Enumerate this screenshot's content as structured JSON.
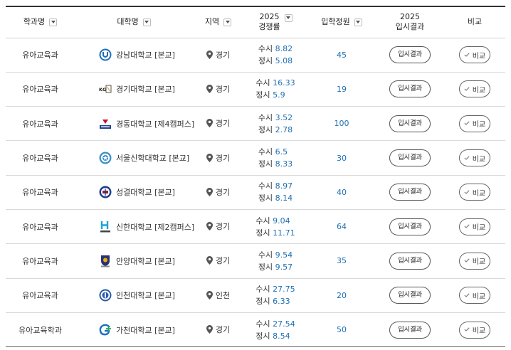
{
  "headers": {
    "dept": "학과명",
    "univ": "대학명",
    "region": "지역",
    "rate_top": "2025",
    "rate_bottom": "경쟁률",
    "quota": "입학정원",
    "result_top": "2025",
    "result_bottom": "입시결과",
    "compare": "비교"
  },
  "susi_label": "수시",
  "jeongsi_label": "정시",
  "result_label": "입시결과",
  "compare_label": "비교",
  "colors": {
    "value_blue": "#1f6fb2",
    "header_border": "#333333"
  },
  "rows": [
    {
      "dept": "유아교육과",
      "univ": "강남대학교 [본교]",
      "logo": "kangnam-logo-icon",
      "region": "경기",
      "susi": "8.82",
      "jeongsi": "5.08",
      "quota": "45"
    },
    {
      "dept": "유아교육과",
      "univ": "경기대학교 [본교]",
      "logo": "kyonggi-logo-icon",
      "region": "경기",
      "susi": "16.33",
      "jeongsi": "5.9",
      "quota": "19"
    },
    {
      "dept": "유아교육과",
      "univ": "경동대학교 [제4캠퍼스]",
      "logo": "kyungdong-logo-icon",
      "region": "경기",
      "susi": "3.52",
      "jeongsi": "2.78",
      "quota": "100"
    },
    {
      "dept": "유아교육과",
      "univ": "서울신학대학교 [본교]",
      "logo": "stu-logo-icon",
      "region": "경기",
      "susi": "6.5",
      "jeongsi": "8.33",
      "quota": "30"
    },
    {
      "dept": "유아교육과",
      "univ": "성결대학교 [본교]",
      "logo": "sungkyul-logo-icon",
      "region": "경기",
      "susi": "8.97",
      "jeongsi": "8.14",
      "quota": "40"
    },
    {
      "dept": "유아교육과",
      "univ": "신한대학교 [제2캠퍼스]",
      "logo": "shinhan-logo-icon",
      "region": "경기",
      "susi": "9.04",
      "jeongsi": "11.71",
      "quota": "64"
    },
    {
      "dept": "유아교육과",
      "univ": "안양대학교 [본교]",
      "logo": "anyang-logo-icon",
      "region": "경기",
      "susi": "9.54",
      "jeongsi": "9.57",
      "quota": "35"
    },
    {
      "dept": "유아교육과",
      "univ": "인천대학교 [본교]",
      "logo": "incheon-logo-icon",
      "region": "인천",
      "susi": "27.75",
      "jeongsi": "6.33",
      "quota": "20"
    },
    {
      "dept": "유아교육학과",
      "univ": "가천대학교 [본교]",
      "logo": "gachon-logo-icon",
      "region": "경기",
      "susi": "27.54",
      "jeongsi": "8.54",
      "quota": "50"
    }
  ]
}
